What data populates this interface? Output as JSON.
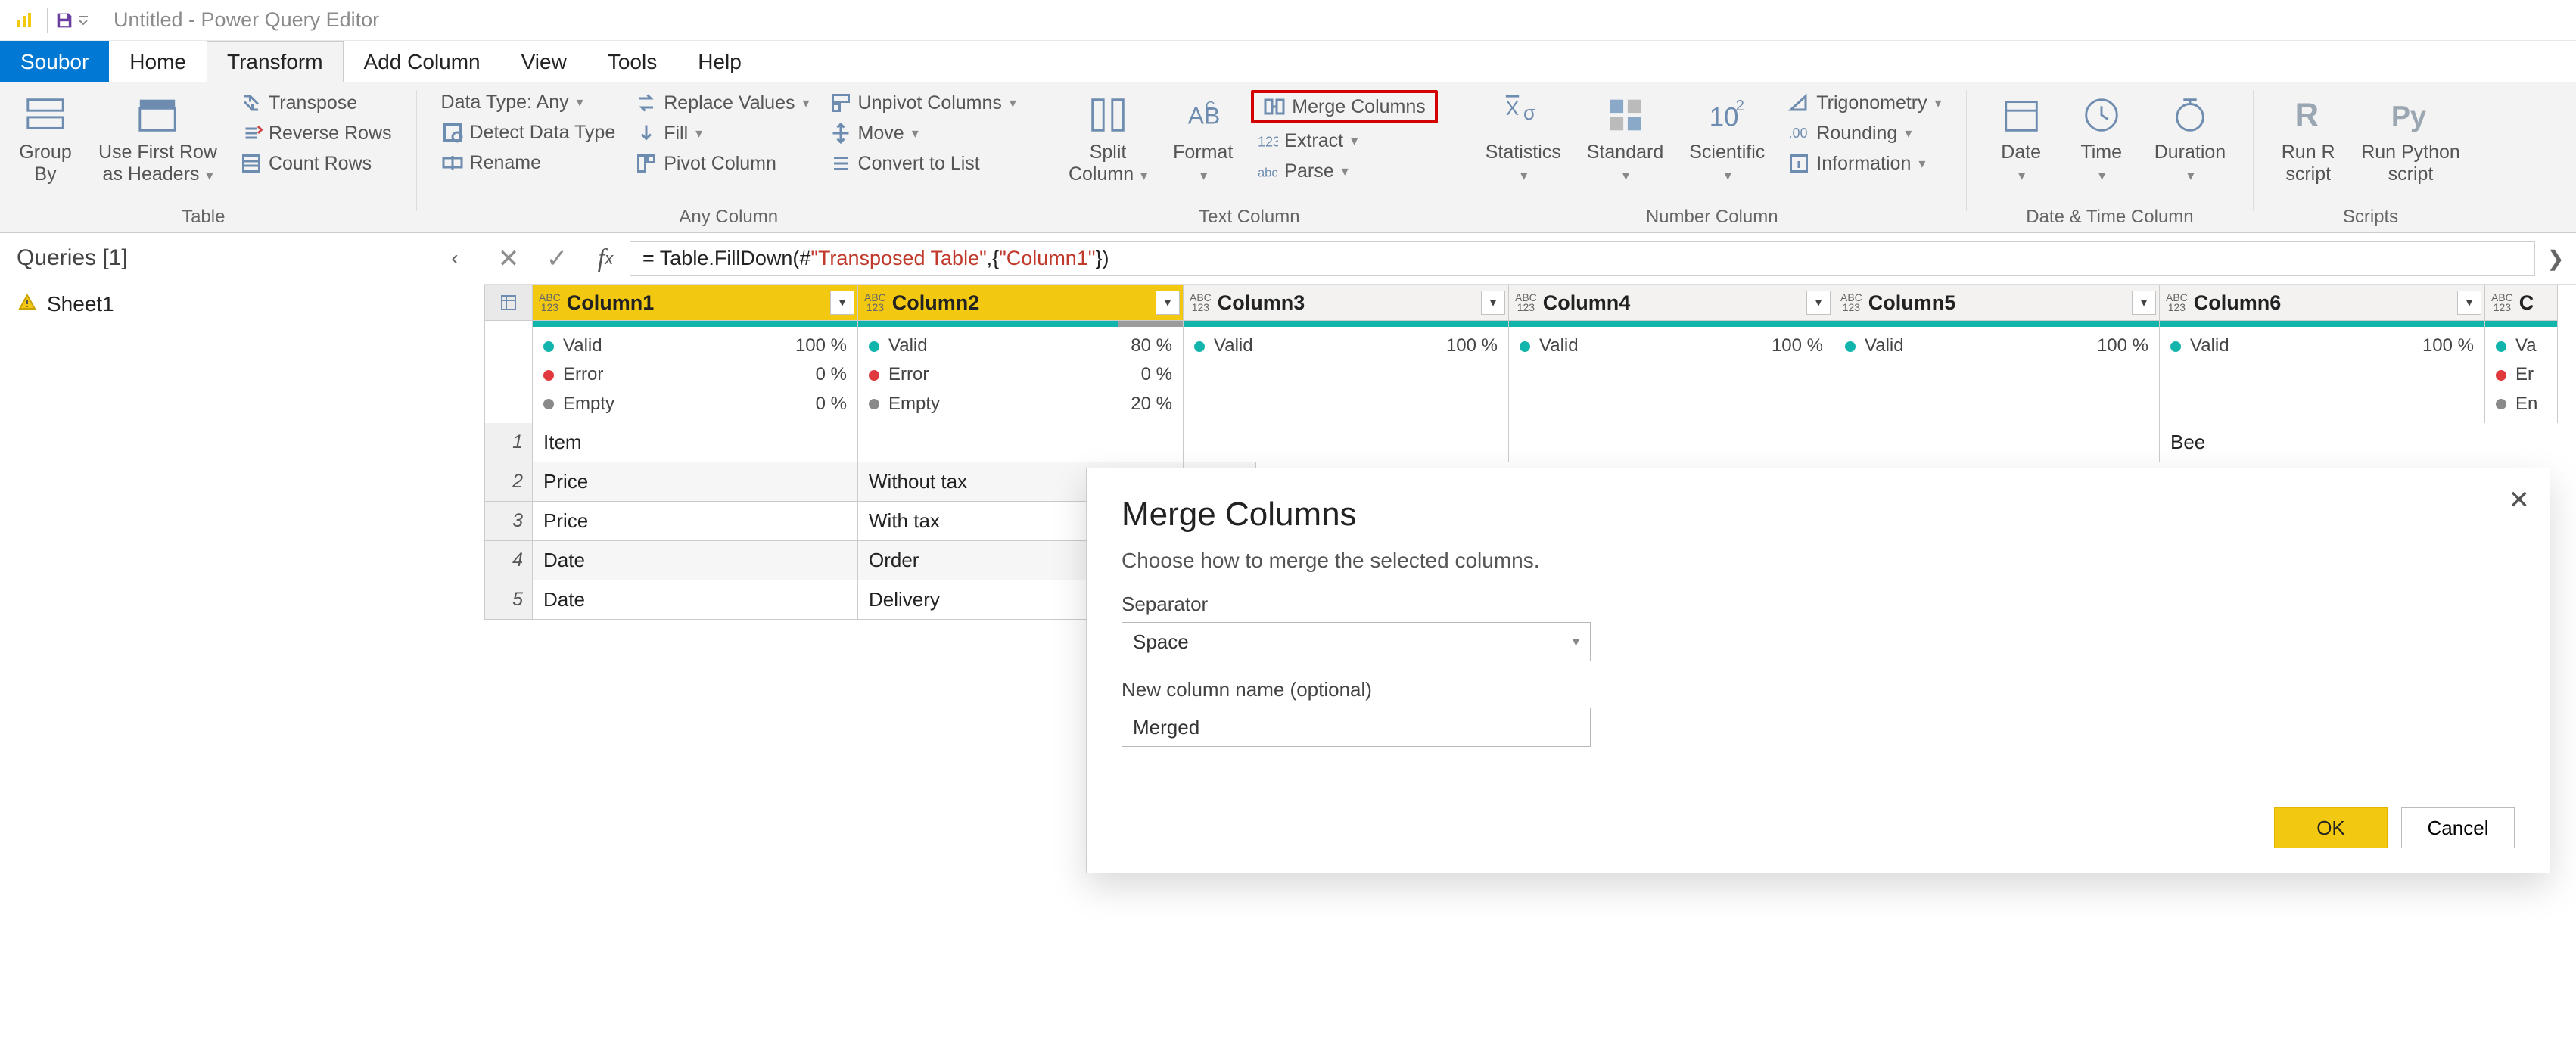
{
  "window": {
    "title": "Untitled - Power Query Editor"
  },
  "tabs": {
    "file": "Soubor",
    "home": "Home",
    "transform": "Transform",
    "addcol": "Add Column",
    "view": "View",
    "tools": "Tools",
    "help": "Help"
  },
  "ribbon": {
    "table": {
      "group": "Table",
      "groupby": "Group\nBy",
      "firstrow": "Use First Row\nas Headers",
      "transpose": "Transpose",
      "reverse": "Reverse Rows",
      "count": "Count Rows"
    },
    "anycol": {
      "group": "Any Column",
      "datatype": "Data Type: Any",
      "detect": "Detect Data Type",
      "rename": "Rename",
      "replace": "Replace Values",
      "fill": "Fill",
      "pivot": "Pivot Column",
      "unpivot": "Unpivot Columns",
      "move": "Move",
      "tolist": "Convert to List"
    },
    "textcol": {
      "group": "Text Column",
      "split": "Split\nColumn",
      "format": "Format",
      "merge": "Merge Columns",
      "extract": "Extract",
      "parse": "Parse"
    },
    "numcol": {
      "group": "Number Column",
      "stats": "Statistics",
      "standard": "Standard",
      "scientific": "Scientific",
      "trig": "Trigonometry",
      "round": "Rounding",
      "info": "Information"
    },
    "datecol": {
      "group": "Date & Time Column",
      "date": "Date",
      "time": "Time",
      "duration": "Duration"
    },
    "scripts": {
      "group": "Scripts",
      "r": "Run R\nscript",
      "py": "Run Python\nscript"
    }
  },
  "queries": {
    "header": "Queries [1]",
    "items": [
      "Sheet1"
    ]
  },
  "formula": {
    "prefix": "= Table.FillDown(#",
    "str": "\"Transposed Table\"",
    "mid": ",{",
    "str2": "\"Column1\"",
    "suffix": "})"
  },
  "grid": {
    "columns": [
      "Column1",
      "Column2",
      "Column3",
      "Column4",
      "Column5",
      "Column6"
    ],
    "lastshort": "C",
    "quality": {
      "valid": "Valid",
      "error": "Error",
      "empty": "Empty",
      "col1": {
        "valid": "100 %",
        "error": "0 %",
        "empty": "0 %",
        "emptypct": 0
      },
      "col2": {
        "valid": "80 %",
        "error": "0 %",
        "empty": "20 %",
        "emptypct": 20
      },
      "col3": {
        "valid": "100 %",
        "emptypct": 0
      },
      "col4": {
        "valid": "100 %",
        "emptypct": 0
      },
      "col5": {
        "valid": "100 %",
        "emptypct": 0
      },
      "col6": {
        "valid": "100 %",
        "emptypct": 0
      },
      "col7": {
        "va": "Va",
        "er": "Er",
        "en": "En"
      }
    },
    "rows": [
      {
        "n": "1",
        "c1": "Item",
        "c2": "",
        "c6": "Bee"
      },
      {
        "n": "2",
        "c1": "Price",
        "c2": "Without tax"
      },
      {
        "n": "3",
        "c1": "Price",
        "c2": "With tax"
      },
      {
        "n": "4",
        "c1": "Date",
        "c2": "Order"
      },
      {
        "n": "5",
        "c1": "Date",
        "c2": "Delivery"
      }
    ]
  },
  "dialog": {
    "title": "Merge Columns",
    "desc": "Choose how to merge the selected columns.",
    "separator_label": "Separator",
    "separator_value": "Space",
    "newname_label": "New column name (optional)",
    "newname_value": "Merged",
    "ok": "OK",
    "cancel": "Cancel"
  }
}
